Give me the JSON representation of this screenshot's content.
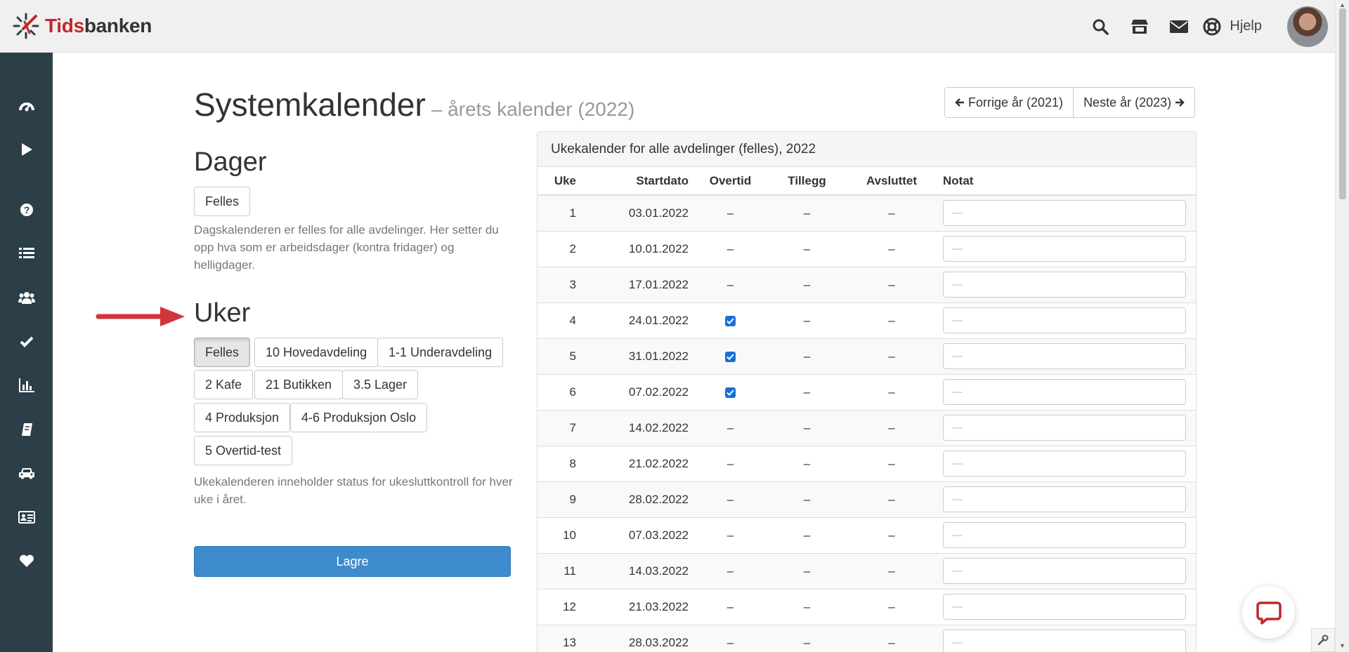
{
  "app": {
    "logo_text_red": "Tids",
    "logo_text_dark": "banken",
    "brand_color": "#c0282d"
  },
  "topbar": {
    "icons": [
      "search-icon",
      "store-icon",
      "envelope-icon"
    ],
    "help_label": "Hjelp"
  },
  "sidebar": {
    "items": [
      "dashboard-icon",
      "play-icon",
      "question-icon",
      "list-icon",
      "users-icon",
      "check-icon",
      "bar-chart-icon",
      "book-icon",
      "car-icon",
      "id-card-icon",
      "heart-icon"
    ]
  },
  "page": {
    "title": "Systemkalender",
    "subtitle": "– årets kalender (2022)",
    "prev_year_label": "Forrige år (2021)",
    "next_year_label": "Neste år (2023)"
  },
  "dager": {
    "title": "Dager",
    "button_label": "Felles",
    "help_text": "Dagskalenderen er felles for alle avdelinger. Her setter du opp hva som er arbeidsdager (kontra fridager) og helligdager."
  },
  "uker": {
    "title": "Uker",
    "departments": [
      "Felles",
      "10 Hovedavdeling",
      "1-1 Underavdeling",
      "2 Kafe",
      "21 Butikken",
      "3.5 Lager",
      "4 Produksjon",
      "4-6 Produksjon Oslo",
      "5 Overtid-test"
    ],
    "active_department": "Felles",
    "help_text": "Ukekalenderen inneholder status for ukesluttkontroll for hver uke i året."
  },
  "save_label": "Lagre",
  "calendar": {
    "heading": "Ukekalender for alle avdelinger (felles), 2022",
    "columns": [
      "Uke",
      "Startdato",
      "Overtid",
      "Tillegg",
      "Avsluttet",
      "Notat"
    ],
    "notat_placeholder": "—",
    "rows": [
      {
        "uke": "1",
        "startdato": "03.01.2022",
        "overtid": "–",
        "tillegg": "–",
        "avsluttet": "–"
      },
      {
        "uke": "2",
        "startdato": "10.01.2022",
        "overtid": "–",
        "tillegg": "–",
        "avsluttet": "–"
      },
      {
        "uke": "3",
        "startdato": "17.01.2022",
        "overtid": "–",
        "tillegg": "–",
        "avsluttet": "–"
      },
      {
        "uke": "4",
        "startdato": "24.01.2022",
        "overtid": "checked",
        "tillegg": "–",
        "avsluttet": "–"
      },
      {
        "uke": "5",
        "startdato": "31.01.2022",
        "overtid": "checked",
        "tillegg": "–",
        "avsluttet": "–"
      },
      {
        "uke": "6",
        "startdato": "07.02.2022",
        "overtid": "checked",
        "tillegg": "–",
        "avsluttet": "–"
      },
      {
        "uke": "7",
        "startdato": "14.02.2022",
        "overtid": "–",
        "tillegg": "–",
        "avsluttet": "–"
      },
      {
        "uke": "8",
        "startdato": "21.02.2022",
        "overtid": "–",
        "tillegg": "–",
        "avsluttet": "–"
      },
      {
        "uke": "9",
        "startdato": "28.02.2022",
        "overtid": "–",
        "tillegg": "–",
        "avsluttet": "–"
      },
      {
        "uke": "10",
        "startdato": "07.03.2022",
        "overtid": "–",
        "tillegg": "–",
        "avsluttet": "–"
      },
      {
        "uke": "11",
        "startdato": "14.03.2022",
        "overtid": "–",
        "tillegg": "–",
        "avsluttet": "–"
      },
      {
        "uke": "12",
        "startdato": "21.03.2022",
        "overtid": "–",
        "tillegg": "–",
        "avsluttet": "–"
      },
      {
        "uke": "13",
        "startdato": "28.03.2022",
        "overtid": "–",
        "tillegg": "–",
        "avsluttet": "–"
      }
    ]
  },
  "colors": {
    "sidebar": "#2c3e48",
    "primary": "#3d8bcd",
    "checkbox": "#1a6fd9",
    "annotation_arrow": "#d1343a"
  }
}
